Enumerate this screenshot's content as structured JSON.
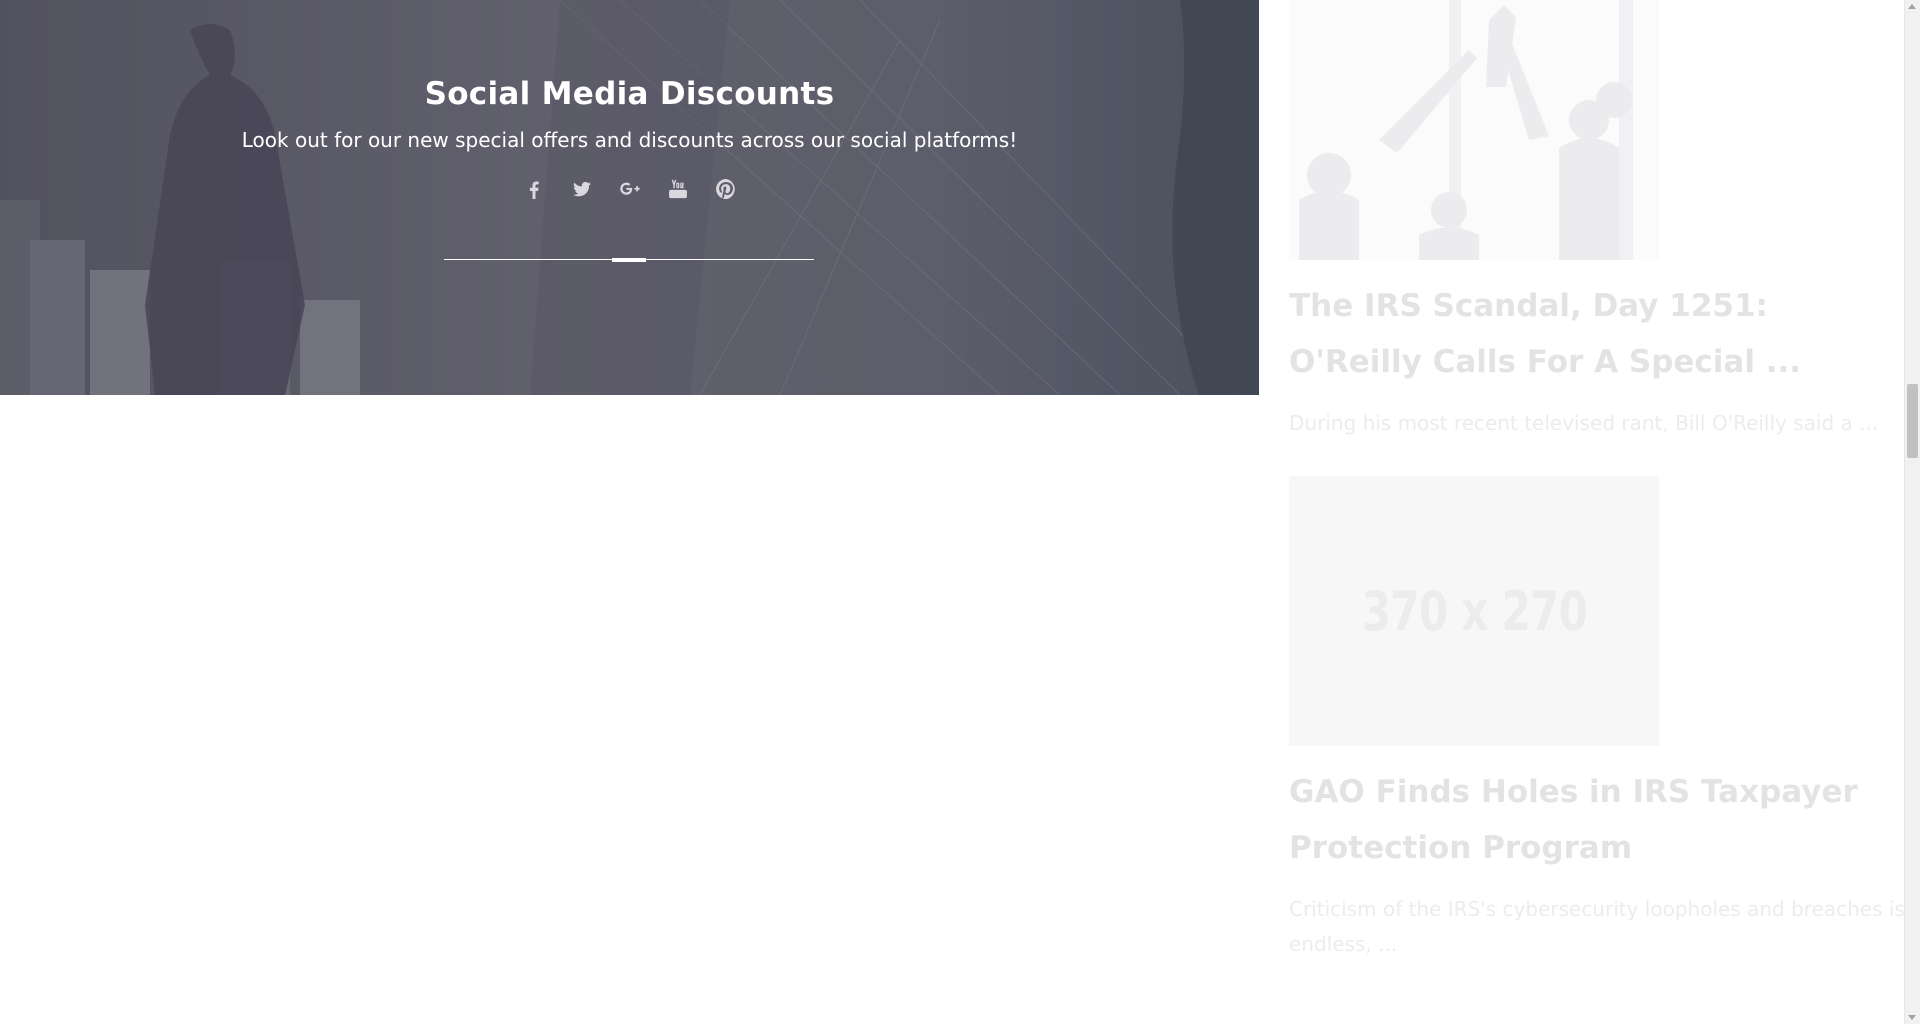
{
  "hero": {
    "title": "Social Media Discounts",
    "subtitle": "Look out for our new special offers and discounts across our social platforms!",
    "social_icons": [
      "facebook-icon",
      "twitter-icon",
      "google-plus-icon",
      "youtube-icon",
      "pinterest-icon"
    ]
  },
  "news": {
    "items": [
      {
        "title": "The IRS Scandal, Day 1251: O'Reilly Calls For A Special ...",
        "excerpt": "During his most recent televised rant, Bill O'Reilly said a ..."
      },
      {
        "image_label": "370 x 270",
        "title": "GAO Finds Holes in IRS Taxpayer Protection Program",
        "excerpt": "Criticism of the IRS's cybersecurity loopholes and breaches is endless, ..."
      }
    ]
  },
  "colors": {
    "hero_overlay": "#5f5e6a",
    "news_title": "#e3e3e3",
    "news_excerpt": "#ececec"
  }
}
